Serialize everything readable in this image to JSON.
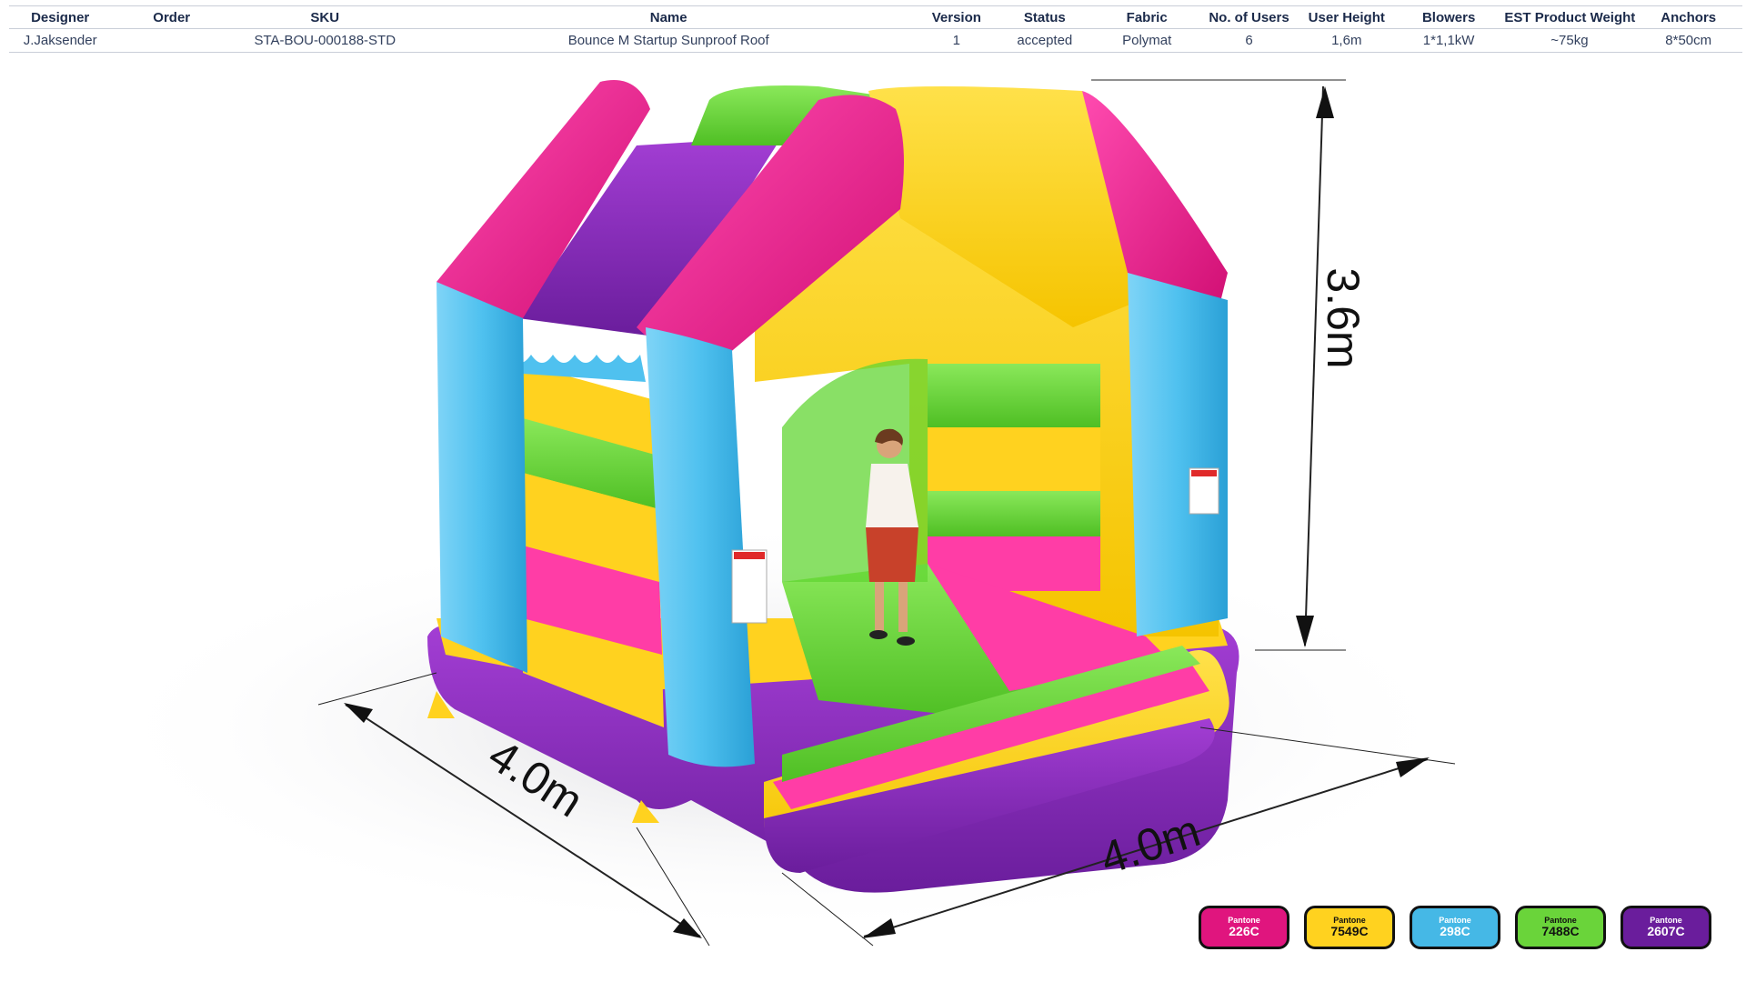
{
  "spec_table": {
    "headers": [
      "Designer",
      "Order",
      "SKU",
      "Name",
      "Version",
      "Status",
      "Fabric",
      "No. of Users",
      "User  Height",
      "Blowers",
      "EST Product Weight",
      "Anchors"
    ],
    "row": [
      "J.Jaksender",
      "",
      "STA-BOU-000188-STD",
      "Bounce M Startup Sunproof Roof",
      "1",
      "accepted",
      "Polymat",
      "6",
      "1,6m",
      "1*1,1kW",
      "~75kg",
      "8*50cm"
    ]
  },
  "dimensions": {
    "height": "3.6m",
    "depth": "4.0m",
    "width": "4.0m"
  },
  "palette": [
    {
      "brand": "Pantone",
      "code": "226C",
      "hex": "#e0157e"
    },
    {
      "brand": "Pantone",
      "code": "7549C",
      "hex": "#ffd21f"
    },
    {
      "brand": "Pantone",
      "code": "298C",
      "hex": "#45b8e6"
    },
    {
      "brand": "Pantone",
      "code": "7488C",
      "hex": "#6ad43a"
    },
    {
      "brand": "Pantone",
      "code": "2607C",
      "hex": "#6a1d9c"
    }
  ]
}
